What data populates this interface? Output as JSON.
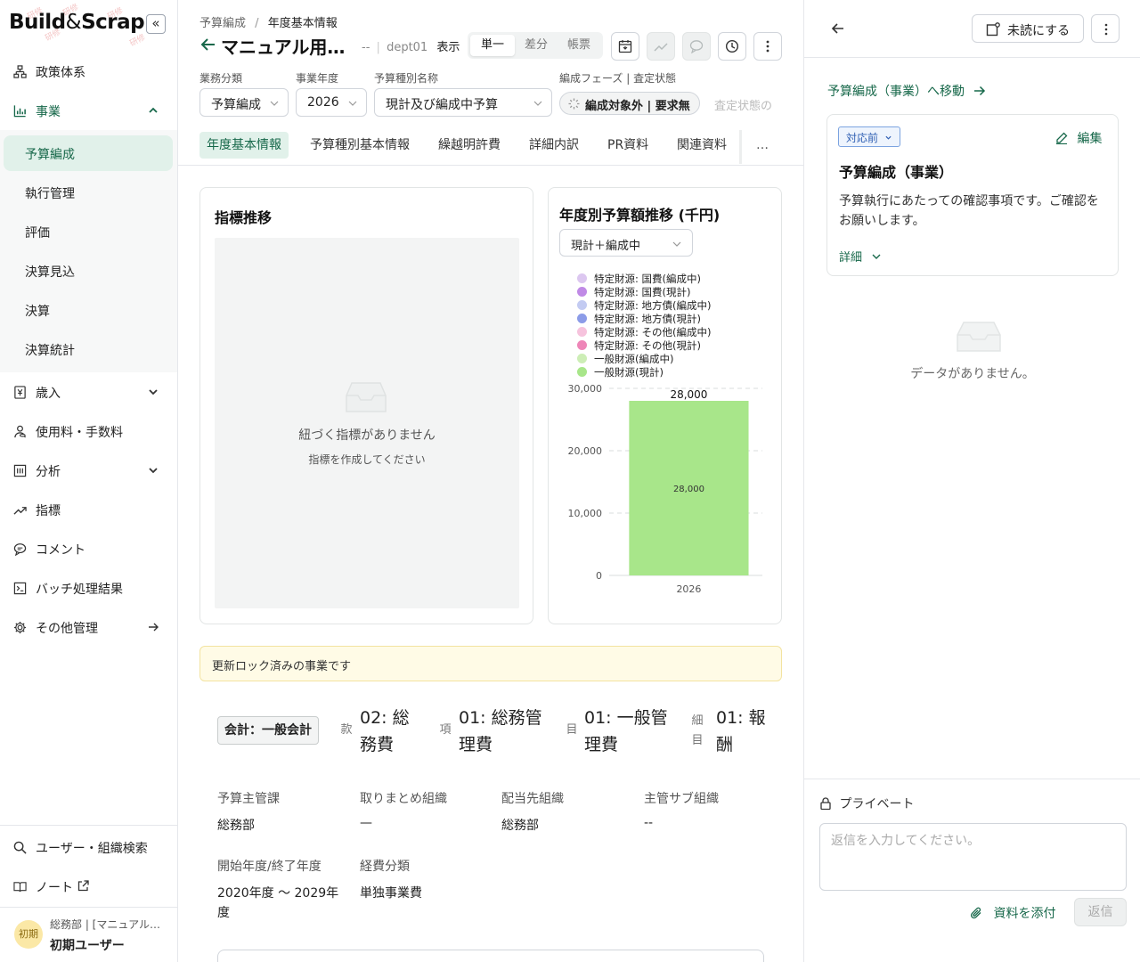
{
  "sidebar": {
    "logo_left": "Build",
    "logo_amp": "&",
    "logo_right": "Scrap",
    "collapse": "«",
    "nav": [
      {
        "label": "政策体系",
        "icon": "hierarchy-icon"
      },
      {
        "label": "事業",
        "icon": "bar-chart-icon"
      },
      {
        "label": "歳入",
        "icon": "yen-doc-icon"
      },
      {
        "label": "使用料・手数料",
        "icon": "user-coins-icon"
      },
      {
        "label": "分析",
        "icon": "report-icon"
      },
      {
        "label": "指標",
        "icon": "trend-icon"
      },
      {
        "label": "コメント",
        "icon": "comment-icon"
      },
      {
        "label": "バッチ処理結果",
        "icon": "terminal-icon"
      },
      {
        "label": "その他管理",
        "icon": "gear-icon"
      }
    ],
    "sub_items": [
      "予算編成",
      "執行管理",
      "評価",
      "決算見込",
      "決算",
      "決算統計"
    ],
    "bottom": [
      {
        "label": "ユーザー・組織検索",
        "icon": "search-icon"
      },
      {
        "label": "ノート",
        "icon": "book-icon"
      }
    ],
    "user": {
      "avatar": "初期",
      "org": "総務部 | [マニュアル…",
      "name": "初期ユーザー"
    }
  },
  "header": {
    "breadcrumb": [
      "予算編成",
      "年度基本情報"
    ],
    "title": "マニュアル用…",
    "meta_dash": "--",
    "meta_dept": "dept01",
    "meta_display": "表示",
    "view_modes": [
      "単一",
      "差分",
      "帳票"
    ],
    "active_mode": "単一"
  },
  "filters": {
    "business": {
      "label": "業務分類",
      "value": "予算編成"
    },
    "year": {
      "label": "事業年度",
      "value": "2026"
    },
    "budget_type": {
      "label": "予算種別名称",
      "value": "現計及び編成中予算"
    },
    "phase": {
      "label": "編成フェーズ | 査定状態",
      "value": "編成対象外 | 要求無"
    },
    "assess_faded": "査定状態の"
  },
  "tabs": [
    "年度基本情報",
    "予算種別基本情報",
    "繰越明許費",
    "詳細内訳",
    "PR資料",
    "関連資料",
    "…"
  ],
  "indicator_card": {
    "title": "指標推移",
    "empty_main": "紐づく指標がありません",
    "empty_sub": "指標を作成してください"
  },
  "budget_card": {
    "title": "年度別予算額推移 (千円)",
    "select": "現計＋編成中"
  },
  "chart_data": {
    "type": "bar",
    "stacked": true,
    "categories": [
      "2026"
    ],
    "series": [
      {
        "name": "特定財源: 国費(編成中)",
        "color": "#dcc7f0",
        "values": [
          0
        ]
      },
      {
        "name": "特定財源: 国費(現計)",
        "color": "#c08ae6",
        "values": [
          0
        ]
      },
      {
        "name": "特定財源: 地方債(編成中)",
        "color": "#c3cbf2",
        "values": [
          0
        ]
      },
      {
        "name": "特定財源: 地方債(現計)",
        "color": "#8c9ce8",
        "values": [
          0
        ]
      },
      {
        "name": "特定財源: その他(編成中)",
        "color": "#f6c3dd",
        "values": [
          0
        ]
      },
      {
        "name": "特定財源: その他(現計)",
        "color": "#ee86b8",
        "values": [
          0
        ]
      },
      {
        "name": "一般財源(編成中)",
        "color": "#cdeeb6",
        "values": [
          0
        ]
      },
      {
        "name": "一般財源(現計)",
        "color": "#a8e68a",
        "values": [
          28000
        ]
      }
    ],
    "totals": [
      "28,000"
    ],
    "segment_labels": [
      "28,000"
    ],
    "y_ticks": [
      "0",
      "10,000",
      "20,000",
      "30,000"
    ],
    "ylim": [
      0,
      30000
    ],
    "legend_position": "top"
  },
  "lock_notice": "更新ロック済みの事業です",
  "account": {
    "chip": "会計：一般会計",
    "kan_label": "款",
    "kan_value": "02: 総務費",
    "kou_label": "項",
    "kou_value": "01: 総務管理費",
    "moku_label": "目",
    "moku_value": "01: 一般管理費",
    "saimoku_label": "細目",
    "saimoku_value": "01: 報酬"
  },
  "info": [
    {
      "label": "予算主管課",
      "value": "総務部"
    },
    {
      "label": "取りまとめ組織",
      "value": "—"
    },
    {
      "label": "配当先組織",
      "value": "総務部"
    },
    {
      "label": "主管サブ組織",
      "value": "--"
    },
    {
      "label": "開始年度/終了年度",
      "value_line1": "2020年度 〜 2029年",
      "value_line2": "度"
    },
    {
      "label": "経費分類",
      "value": "単独事業費"
    }
  ],
  "right_panel": {
    "unread_label": "未読にする",
    "move_link": "予算編成（事業）へ移動",
    "status": "対応前",
    "edit": "編集",
    "card_title": "予算編成（事業）",
    "card_body": "予算執行にあたっての確認事項です。ご確認をお願いします。",
    "detail": "詳細",
    "no_data": "データがありません。",
    "private": "プライベート",
    "reply_placeholder": "返信を入力してください。",
    "attach": "資料を添付",
    "reply": "返信"
  }
}
